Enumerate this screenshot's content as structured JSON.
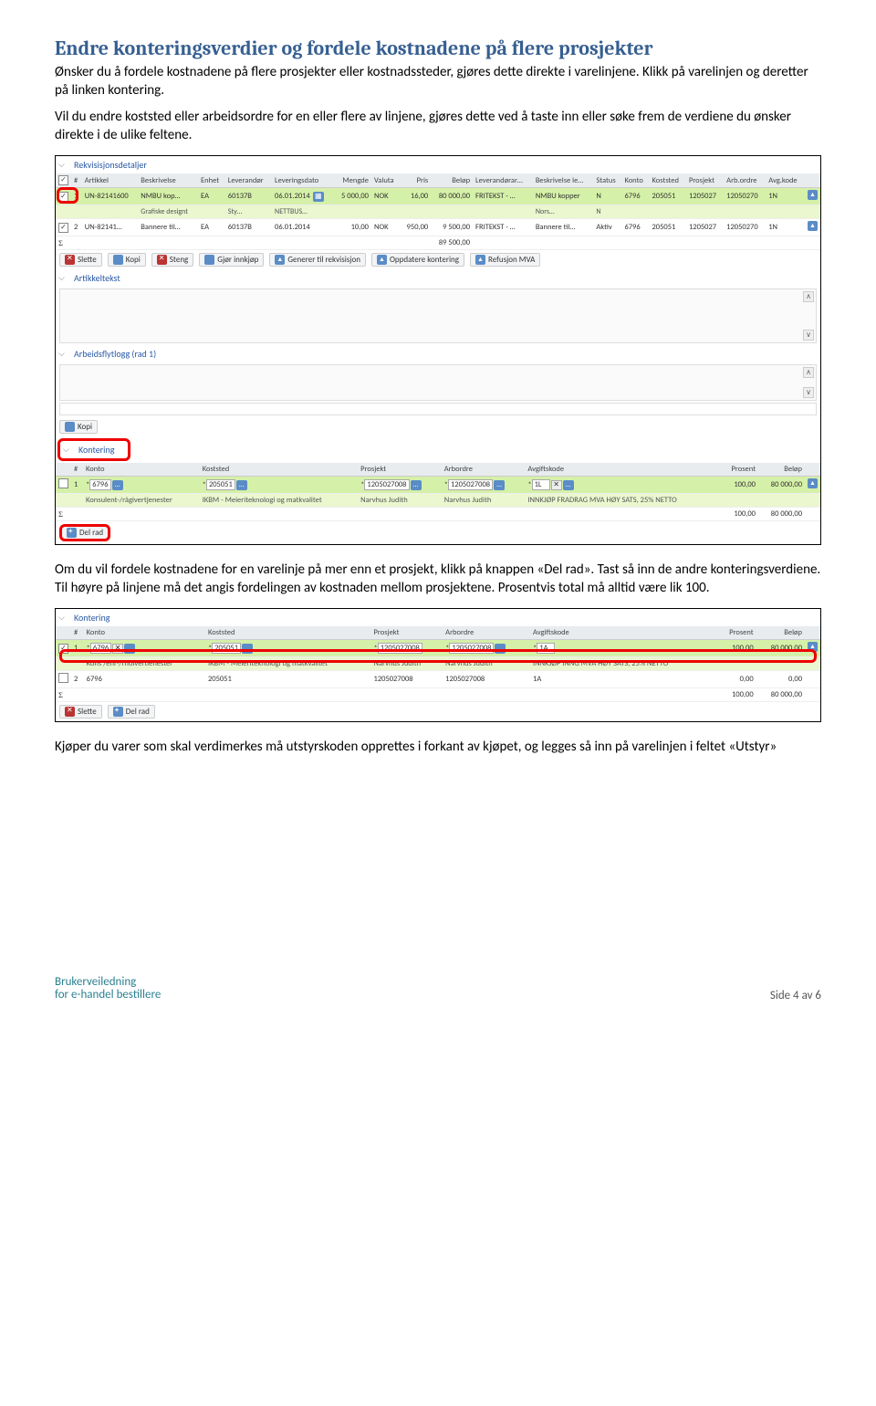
{
  "heading": "Endre konteringsverdier og fordele kostnadene på flere prosjekter",
  "para1": "Ønsker du å fordele kostnadene på flere prosjekter eller kostnadssteder, gjøres dette direkte i varelinjene. Klikk på varelinjen og deretter på linken kontering.",
  "para2": "Vil du endre koststed eller arbeidsordre for en eller flere av linjene, gjøres dette ved å taste inn eller søke frem de verdiene du ønsker direkte i de ulike feltene.",
  "para3": "Om du vil fordele kostnadene for en varelinje på mer enn et prosjekt, klikk på knappen «Del rad». Tast så inn de andre konteringsverdiene. Til høyre på linjene må det angis fordelingen av kostnaden mellom prosjektene. Prosentvis total må alltid være lik 100.",
  "para4": "Kjøper du varer som skal verdimerkes må utstyrskoden opprettes i forkant av kjøpet, og legges så inn på varelinjen i feltet «Utstyr»",
  "screenshot1": {
    "section_req": "Rekvisisjonsdetaljer",
    "headers": [
      "#",
      "Artikkel",
      "Beskrivelse",
      "Enhet",
      "Leverandør",
      "Leveringsdato",
      "Mengde",
      "Valuta",
      "Pris",
      "Beløp",
      "Leverandørar…",
      "Beskrivelse le…",
      "Status",
      "Konto",
      "Koststed",
      "Prosjekt",
      "Arb.ordre",
      "Avg.kode"
    ],
    "rows": [
      {
        "n": "1",
        "art": "UN-82141600",
        "besk": "NMBU kop…",
        "enh": "EA",
        "lev": "60137B",
        "dato": "06.01.2014",
        "mng": "5 000,00",
        "val": "NOK",
        "pris": "16,00",
        "belop": "80 000,00",
        "la": "FRITEKST - …",
        "bl": "NMBU kopper",
        "st": "N",
        "konto": "6796",
        "ks": "205051",
        "pr": "1205027",
        "ao": "12050270",
        "ak": "1N"
      },
      {
        "n": "",
        "art": "",
        "besk": "Grafiske designt",
        "enh": "",
        "lev": "Sty…",
        "dato": "NETTBUS…",
        "mng": "",
        "val": "",
        "pris": "",
        "belop": "",
        "la": "",
        "bl": "Nors…",
        "st": "N",
        "konto": "",
        "ks": "",
        "pr": "",
        "ao": "",
        "ak": ""
      },
      {
        "n": "2",
        "art": "UN-82141…",
        "besk": "Bannere til…",
        "enh": "EA",
        "lev": "60137B",
        "dato": "06.01.2014",
        "mng": "10,00",
        "val": "NOK",
        "pris": "950,00",
        "belop": "9 500,00",
        "la": "FRITEKST - …",
        "bl": "Bannere til…",
        "st": "Aktiv",
        "konto": "6796",
        "ks": "205051",
        "pr": "1205027",
        "ao": "12050270",
        "ak": "1N"
      }
    ],
    "sum": "89 500,00",
    "toolbar": {
      "slette": "Slette",
      "kopi": "Kopi",
      "steng": "Steng",
      "gjor": "Gjør innkjøp",
      "gen": "Generer til rekvisisjon",
      "opp": "Oppdatere kontering",
      "ref": "Refusjon MVA"
    },
    "artikkeltekst": "Artikkeltekst",
    "arbeidsflyt": "Arbeidsflytlogg (rad 1)",
    "kopi2": "Kopi",
    "kontering": "Kontering",
    "khead": [
      "#",
      "Konto",
      "Koststed",
      "Prosjekt",
      "Arbordre",
      "Avgiftskode",
      "Prosent",
      "Beløp"
    ],
    "krow": {
      "n": "1",
      "konto": "6796",
      "konto_d": "Konsulent-/rågivertjenester",
      "ks": "205051",
      "ks_d": "IKBM - Meieriteknologi og matkvalitet",
      "pr": "1205027008",
      "pr_d": "Narvhus Judith",
      "ao": "1205027008",
      "ao_d": "Narvhus Judith",
      "ak": "1L",
      "ak_d": "INNKJØP FRADRAG MVA HØY SATS, 25% NETTO",
      "pct": "100,00",
      "bel": "80 000,00"
    },
    "ktot_pct": "100,00",
    "ktot_bel": "80 000,00",
    "delrad": "Del rad"
  },
  "screenshot2": {
    "kontering": "Kontering",
    "khead": [
      "#",
      "Konto",
      "Koststed",
      "Prosjekt",
      "Arbordre",
      "Avgiftskode",
      "Prosent",
      "Beløp"
    ],
    "r1": {
      "n": "1",
      "konto": "6796",
      "ks": "205051",
      "pr": "1205027008",
      "ao": "1205027008",
      "ak": "1A",
      "pct": "100,00",
      "bel": "80 000,00"
    },
    "r1sub": {
      "konto": "Kons /enr-/rfloivertienester",
      "ks": "IKBM - Meieriteknologi og matkvalitet",
      "pr": "Narvhus Judith",
      "ao": "Narvhus Judith",
      "ak": "INNKJØP INNG MVA HØY SATS, 25% NETTO"
    },
    "r2": {
      "n": "2",
      "konto": "6796",
      "ks": "205051",
      "pr": "1205027008",
      "ao": "1205027008",
      "ak": "1A",
      "pct": "0,00",
      "bel": "0,00"
    },
    "tot_pct": "100,00",
    "tot_bel": "80 000,00",
    "slette": "Slette",
    "delrad": "Del rad"
  },
  "footer": {
    "l1": "Brukerveiledning",
    "l2": "for e-handel bestillere",
    "right": "Side 4 av 6"
  }
}
